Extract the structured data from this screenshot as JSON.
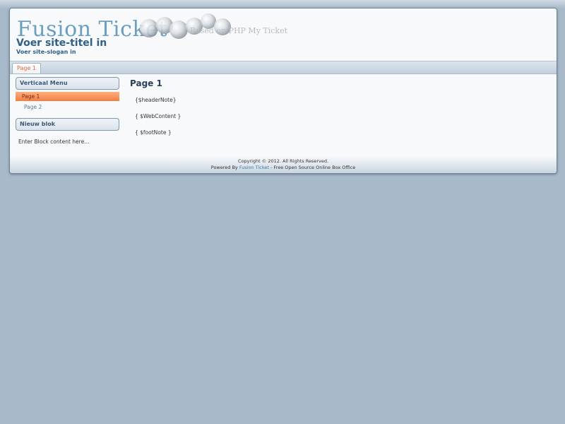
{
  "header": {
    "logo_text": "Fusion Ticket",
    "logo_tagline": "Based on PHP My Ticket",
    "site_title": "Voer site-titel in",
    "site_slogan": "Voer site-slogan in"
  },
  "navbar": {
    "tabs": [
      {
        "label": "Page 1",
        "active": true
      }
    ]
  },
  "sidebar": {
    "menu_block_title": "Verticaal Menu",
    "menu_items": [
      {
        "label": "Page 1",
        "active": true
      },
      {
        "label": "Page 2",
        "active": false
      }
    ],
    "new_block_title": "Nieuw blok",
    "new_block_content": "Enter Block content here..."
  },
  "main": {
    "title": "Page 1",
    "lines": [
      "{$headerNote}",
      "{ $WebContent }",
      "{ $footNote }"
    ]
  },
  "footer": {
    "copyright": "Copyright © 2012. All Rights Reserved.",
    "powered_prefix": "Powered By ",
    "powered_link": "Fusion Ticket",
    "powered_suffix": " - Free Open Source Online Box Office"
  },
  "colors": {
    "background": "#a8b9c9",
    "accent_orange": "#f27f44",
    "title_blue": "#2e6088",
    "link_blue": "#3c78a8"
  },
  "icons": [
    "bubbles-logo-graphic"
  ]
}
